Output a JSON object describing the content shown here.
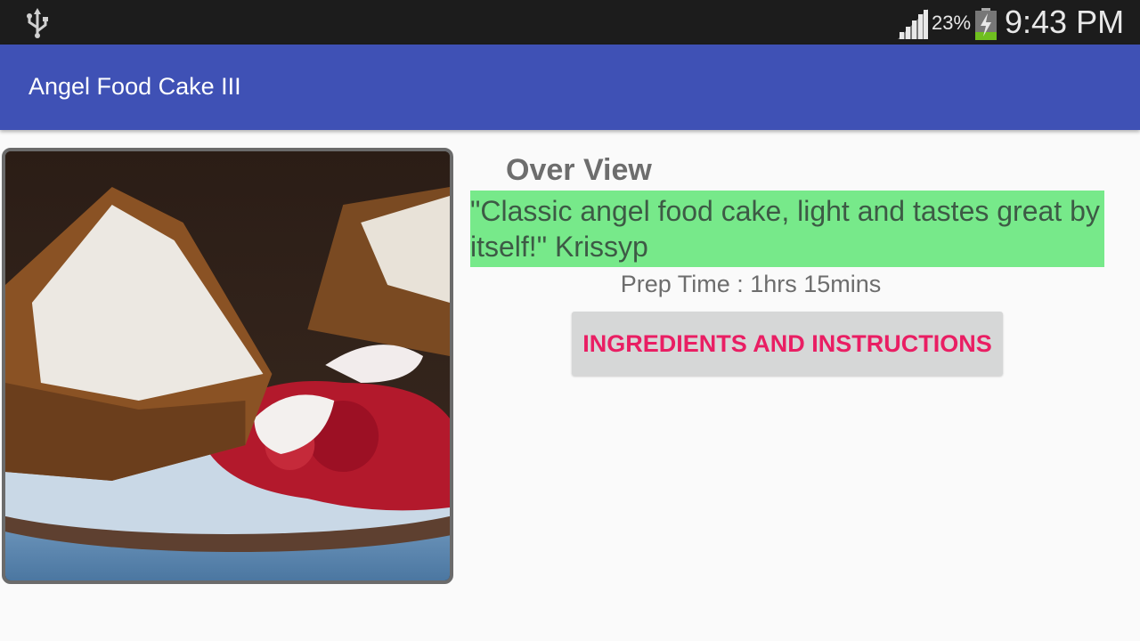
{
  "status_bar": {
    "battery_percent": "23%",
    "time": "9:43 PM",
    "icons": [
      "usb-icon",
      "signal-icon",
      "battery-charging-icon"
    ]
  },
  "app_bar": {
    "title": "Angel Food Cake III",
    "color": "#3f51b5"
  },
  "recipe": {
    "image_subject": "angel food cake slice with berry sauce",
    "overview_heading": "Over View",
    "description": "\"Classic angel food cake, light and tastes great by itself!\"  Krissyp",
    "prep_time": "Prep Time : 1hrs 15mins",
    "button_label": "INGREDIENTS AND INSTRUCTIONS"
  },
  "colors": {
    "description_bg": "#77e98a",
    "button_text": "#e91e63",
    "button_bg": "#d6d7d7"
  }
}
